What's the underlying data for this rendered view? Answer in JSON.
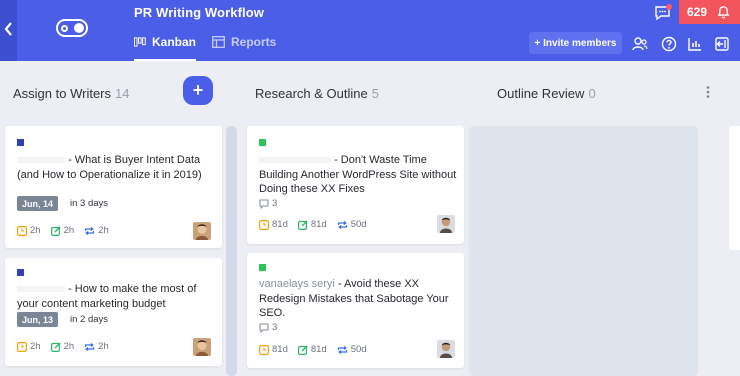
{
  "header": {
    "project_title": "PR Writing Workflow",
    "tabs": [
      {
        "label": "Kanban",
        "icon": "kanban-icon",
        "active": true
      },
      {
        "label": "Reports",
        "icon": "reports-icon",
        "active": false
      }
    ],
    "invite_label": "+ Invite members",
    "notifications_count": "629",
    "colors": {
      "primary": "#4a5ee8",
      "notification": "#f2555d"
    }
  },
  "columns": [
    {
      "name": "Assign to Writers",
      "count": "14"
    },
    {
      "name": "Research & Outline",
      "count": "5"
    },
    {
      "name": "Outline Review",
      "count": "0"
    }
  ],
  "cards": [
    {
      "title": "- What is Buyer Intent Data (and How to Operationalize it in 2019)",
      "label_color": "#2f3fbf",
      "date": "Jun, 14",
      "due": "in 3 days",
      "metrics": [
        "2h",
        "2h",
        "2h"
      ]
    },
    {
      "title": "- How to make the most of your content marketing budget",
      "label_color": "#2f3fbf",
      "date": "Jun, 13",
      "due": "in 2 days",
      "metrics": [
        "2h",
        "2h",
        "2h"
      ]
    },
    {
      "title": "- Don't Waste Time Building Another WordPress Site without Doing these XX Fixes",
      "label_color": "#2fc15a",
      "comments": "3",
      "metrics": [
        "81d",
        "81d",
        "50d"
      ]
    },
    {
      "title_prefix": "vanaelays seryi",
      "title": "- Avoid these XX Redesign Mistakes that Sabotage Your SEO.",
      "label_color": "#2fc15a",
      "comments": "3",
      "metrics": [
        "81d",
        "81d",
        "50d"
      ]
    }
  ]
}
